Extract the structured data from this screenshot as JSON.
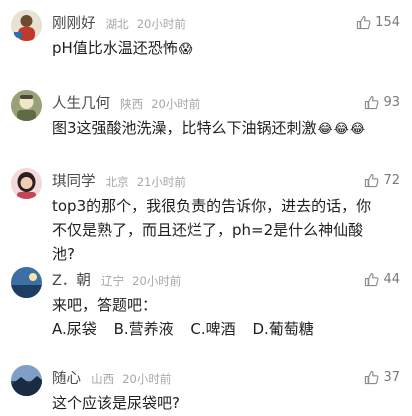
{
  "comments": [
    {
      "name": "刚刚好",
      "location": "湖北",
      "time": "20小时前",
      "likes": "154",
      "text": "pH值比水温还恐怖",
      "emojis": [
        "😱"
      ]
    },
    {
      "name": "人生几何",
      "location": "陕西",
      "time": "20小时前",
      "likes": "93",
      "text": "图3这强酸池洗澡，比特么下油锅还刺激",
      "emojis": [
        "😂",
        "😂",
        "😂"
      ]
    },
    {
      "name": "琪同学",
      "location": "北京",
      "time": "21小时前",
      "likes": "72",
      "text": "top3的那个，我很负责的告诉你，进去的话，你不仅是熟了，而且还烂了，ph=2是什么神仙酸池?"
    },
    {
      "name": "Z．朝",
      "location": "辽宁",
      "time": "20小时前",
      "likes": "44",
      "line1": "来吧，答题吧：",
      "choices": [
        "A.尿袋",
        "B.营养液",
        "C.啤酒",
        "D.葡萄糖"
      ]
    },
    {
      "name": "随心",
      "location": "山西",
      "time": "20小时前",
      "likes": "37",
      "text": "这个应该是尿袋吧?"
    }
  ],
  "icons": {
    "like": "thumbs-up-icon"
  }
}
